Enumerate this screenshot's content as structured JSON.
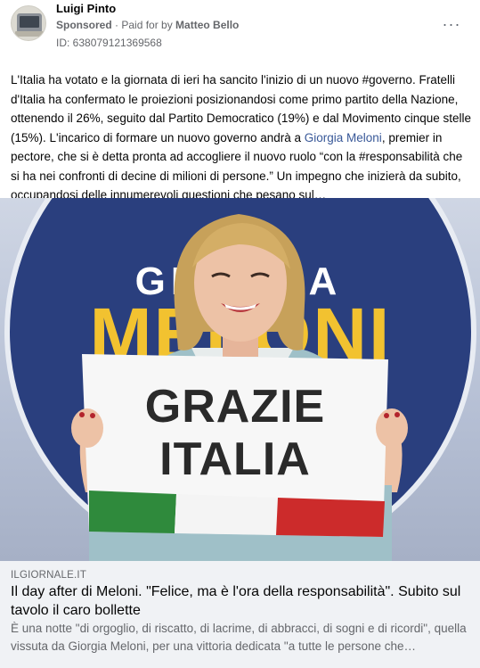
{
  "post": {
    "author": "Luigi Pinto",
    "sponsored_label": "Sponsored",
    "separator": " · ",
    "paid_by_prefix": "Paid for by ",
    "payer": "Matteo Bello",
    "ad_id": "ID: 638079121369568",
    "more_icon": "more-horizontal-icon",
    "more_label": "···",
    "text_part1": "L'Italia ha votato e la giornata di ieri ha sancito l'inizio di un nuovo #governo. Fratelli d'Italia ha confermato le proiezioni posizionandosi come primo partito della Nazione, ottenendo il 26%, seguito dal Partito Democratico (19%) e dal Movimento cinque stelle (15%). L'incarico di formare un nuovo governo andrà a ",
    "text_mention": "Giorgia Meloni",
    "text_part2": ", premier in pectore, che si è detta pronta ad accogliere il nuovo ruolo “con la #responsabilità che si ha nei confronti di decine di milioni di persone.” Un impegno che inizierà da subito, occupandosi delle innumerevoli questioni che pesano sul…"
  },
  "image": {
    "backdrop_line1": "GIORGIA",
    "backdrop_line2": "MELONI",
    "sign_line1": "GRAZIE",
    "sign_line2": "ITALIA",
    "colors": {
      "backdrop_blue": "#2a3f7e",
      "backdrop_gold": "#f2c230",
      "flag_green": "#2f8a3c",
      "flag_white": "#f4f4f4",
      "flag_red": "#cc2b2b",
      "jacket": "#9fc0c8"
    }
  },
  "link": {
    "domain": "ILGIORNALE.IT",
    "title": "Il day after di Meloni. \"Felice, ma è l'ora della responsabilità\". Subito sul tavolo il caro bollette",
    "description": "È una notte \"di orgoglio, di riscatto, di lacrime, di abbracci, di sogni e di ricordi\", quella vissuta da Giorgia Meloni, per una vittoria dedicata \"a tutte le persone che…"
  }
}
